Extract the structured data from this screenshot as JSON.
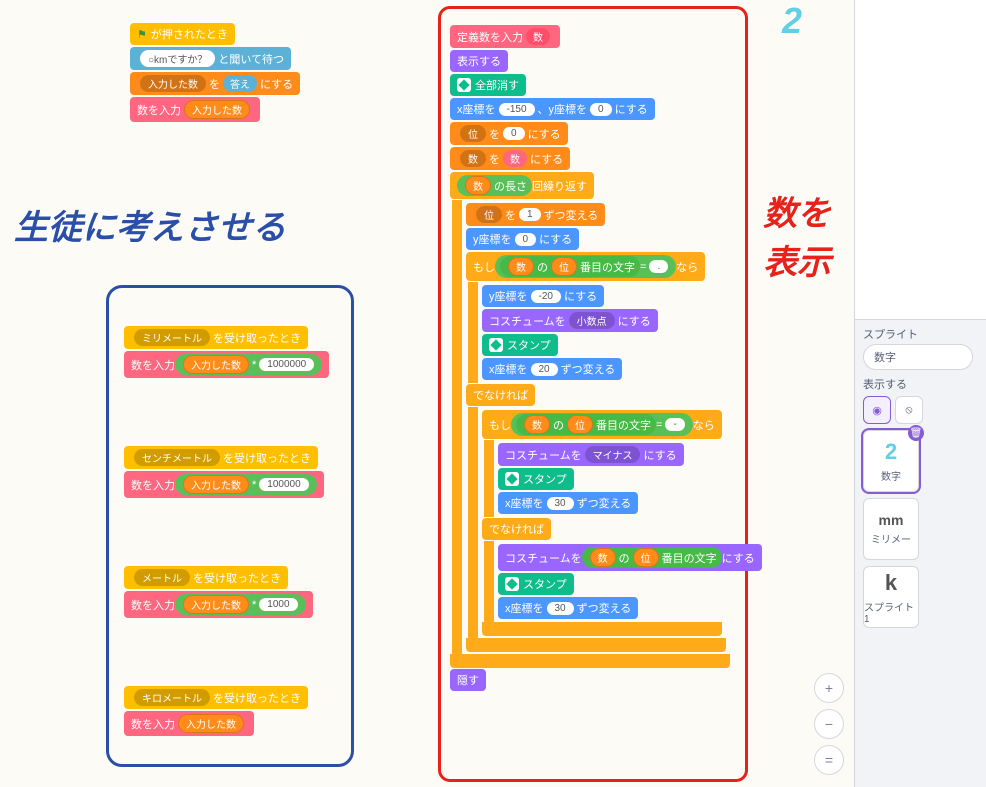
{
  "captions": {
    "left": "生徒に考えさせる",
    "right": "数を表示"
  },
  "script_main": {
    "hat": "が押されたとき",
    "ask1_prompt": "○kmですか？",
    "ask1_tail": "と聞いて待つ",
    "set_var": "入力した数",
    "set_mid": "を",
    "answer": "答え",
    "set_tail": "にする",
    "call": "数を入力",
    "call_arg": "入力した数"
  },
  "student_blocks": [
    {
      "hat_unit": "ミリメートル",
      "hat_tail": "を受け取ったとき",
      "call": "数を入力",
      "arg_var": "入力した数",
      "op": "*",
      "const": "1000000"
    },
    {
      "hat_unit": "センチメートル",
      "hat_tail": "を受け取ったとき",
      "call": "数を入力",
      "arg_var": "入力した数",
      "op": "*",
      "const": "100000"
    },
    {
      "hat_unit": "メートル",
      "hat_tail": "を受け取ったとき",
      "call": "数を入力",
      "arg_var": "入力した数",
      "op": "*",
      "const": "1000"
    },
    {
      "hat_unit": "キロメートル",
      "hat_tail": "を受け取ったとき",
      "call": "数を入力",
      "arg_var": "入力した数",
      "op": "",
      "const": ""
    }
  ],
  "define": {
    "label": "定義",
    "name": "数を入力",
    "param": "数",
    "show": "表示する",
    "eraseall": "全部消す",
    "goto_pre": "x座標を",
    "goto_x": "-150",
    "goto_mid": "、y座標を",
    "goto_y": "0",
    "goto_tail": "にする",
    "setpos_var": "位",
    "setpos_mid": "を",
    "setpos_val": "0",
    "setpos_tail": "にする",
    "setnum_var": "数",
    "setnum_mid": "を",
    "setnum_arg": "数",
    "setnum_tail": "にする",
    "repeat_arg": "数",
    "repeat_len": "の長さ",
    "repeat_tail": "回繰り返す",
    "changepos_var": "位",
    "changepos_mid": "を",
    "changepos_val": "1",
    "changepos_tail": "ずつ変える",
    "sety_pre": "y座標を",
    "sety_val": "0",
    "sety_tail": "にする",
    "if_head": "もし",
    "if_tail": "なら",
    "letter_a": "数",
    "letter_mid": "の",
    "letter_b": "位",
    "letter_tail": "番目の文字",
    "eq": "=",
    "dot": ".",
    "sety2_val": "-20",
    "costume_pre": "コスチュームを",
    "costume_dot": "小数点",
    "costume_tail": "にする",
    "stamp": "スタンプ",
    "changex_pre": "x座標を",
    "changex_val": "20",
    "changex_tail": "ずつ変える",
    "else": "でなければ",
    "minus": "-",
    "costume_minus": "マイナス",
    "changex2_val": "30",
    "costume_digit_tail": "にする",
    "changex3_val": "30",
    "hide": "隠す"
  },
  "right_panel": {
    "sprite_label": "スプライト",
    "sprite_name": "数字",
    "show_label": "表示する",
    "thumbs": [
      {
        "glyph": "2",
        "label": "数字",
        "selected": true
      },
      {
        "glyph": "mm",
        "label": "ミリメー",
        "selected": false
      },
      {
        "glyph": "k",
        "label": "スプライト1",
        "selected": false
      }
    ]
  },
  "zoom": {
    "in": "+",
    "out": "−",
    "eq": "="
  },
  "corner_glyph": "2"
}
